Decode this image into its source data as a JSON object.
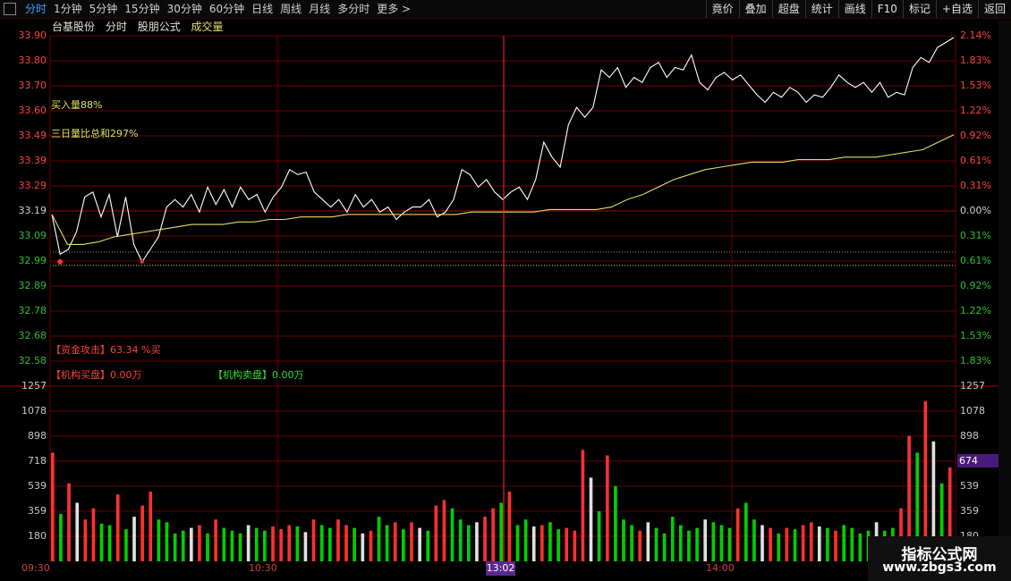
{
  "toolbar": {
    "tabs": [
      "分时",
      "1分钟",
      "5分钟",
      "15分钟",
      "30分钟",
      "60分钟",
      "日线",
      "周线",
      "月线",
      "多分时",
      "更多 >"
    ],
    "active_tab": "分时",
    "right_buttons": [
      "竟价",
      "叠加",
      "超盘",
      "统计",
      "画线",
      "F10",
      "标记",
      "+自选",
      "返回"
    ]
  },
  "chart_header": {
    "stock_name": "台基股份",
    "mode": "分时",
    "formula": "股朋公式",
    "indicator": "成交量"
  },
  "annotations": {
    "buy_ratio": "买入量88%",
    "three_day": "三日量比总和297%",
    "fund_attack": "【资金攻击】63.34 %买",
    "inst_buy": "【机构买盘】0.00万",
    "inst_sell": "【机构卖盘】0.00万"
  },
  "price_axis": {
    "left": [
      "33.90",
      "33.80",
      "33.70",
      "33.60",
      "33.49",
      "33.39",
      "33.29",
      "33.19",
      "33.09",
      "32.99",
      "32.89",
      "32.78",
      "32.68",
      "32.58"
    ],
    "right": [
      "2.14%",
      "1.83%",
      "1.53%",
      "1.22%",
      "0.92%",
      "0.61%",
      "0.31%",
      "0.00%",
      "0.31%",
      "0.61%",
      "0.92%",
      "1.22%",
      "1.53%",
      "1.83%"
    ]
  },
  "volume_axis": [
    "1257",
    "1078",
    "898",
    "718",
    "539",
    "359",
    "180"
  ],
  "volume_current": "674",
  "time_axis": [
    "09:30",
    "10:30",
    "13:02",
    "14:00"
  ],
  "watermark": {
    "title": "指标公式网",
    "url": "www.zbgs3.com"
  },
  "colors": {
    "up": "#ff3030",
    "down": "#00d000",
    "price_line": "#ffffff",
    "avg_line": "#e0e060",
    "grid": "#6a0000",
    "axis_up": "#ff4040",
    "axis_down": "#30c030"
  },
  "chart_data": {
    "type": "line",
    "price": [
      33.19,
      33.03,
      33.05,
      33.12,
      33.26,
      33.28,
      33.18,
      33.27,
      33.1,
      33.26,
      33.07,
      33.0,
      33.05,
      33.1,
      33.22,
      33.25,
      33.22,
      33.27,
      33.2,
      33.3,
      33.23,
      33.29,
      33.22,
      33.3,
      33.25,
      33.27,
      33.2,
      33.26,
      33.3,
      33.37,
      33.35,
      33.36,
      33.28,
      33.25,
      33.22,
      33.25,
      33.2,
      33.27,
      33.22,
      33.25,
      33.2,
      33.22,
      33.17,
      33.2,
      33.22,
      33.22,
      33.25,
      33.18,
      33.2,
      33.25,
      33.37,
      33.35,
      33.3,
      33.33,
      33.28,
      33.25,
      33.28,
      33.3,
      33.25,
      33.33,
      33.48,
      33.42,
      33.38,
      33.55,
      33.62,
      33.58,
      33.62,
      33.77,
      33.74,
      33.78,
      33.7,
      33.74,
      33.72,
      33.78,
      33.8,
      33.74,
      33.78,
      33.77,
      33.83,
      33.72,
      33.69,
      33.74,
      33.76,
      33.73,
      33.75,
      33.71,
      33.67,
      33.64,
      33.68,
      33.66,
      33.7,
      33.68,
      33.64,
      33.67,
      33.66,
      33.7,
      33.75,
      33.72,
      33.7,
      33.72,
      33.68,
      33.72,
      33.66,
      33.68,
      33.67,
      33.78,
      33.82,
      33.8,
      33.86,
      33.88,
      33.9
    ],
    "avg": [
      33.19,
      33.07,
      33.07,
      33.08,
      33.1,
      33.11,
      33.12,
      33.13,
      33.14,
      33.15,
      33.15,
      33.15,
      33.16,
      33.16,
      33.17,
      33.17,
      33.18,
      33.18,
      33.18,
      33.19,
      33.19,
      33.19,
      33.19,
      33.19,
      33.19,
      33.19,
      33.19,
      33.2,
      33.2,
      33.2,
      33.2,
      33.2,
      33.21,
      33.21,
      33.21,
      33.21,
      33.22,
      33.25,
      33.27,
      33.3,
      33.33,
      33.35,
      33.37,
      33.38,
      33.39,
      33.4,
      33.4,
      33.4,
      33.41,
      33.41,
      33.41,
      33.42,
      33.42,
      33.42,
      33.43,
      33.44,
      33.45,
      33.48,
      33.51
    ],
    "volume": [
      780,
      340,
      560,
      420,
      300,
      380,
      270,
      260,
      480,
      230,
      320,
      400,
      500,
      300,
      280,
      200,
      220,
      240,
      260,
      200,
      300,
      240,
      220,
      200,
      260,
      240,
      220,
      250,
      230,
      260,
      250,
      210,
      300,
      260,
      240,
      300,
      260,
      240,
      200,
      220,
      320,
      260,
      280,
      230,
      280,
      240,
      220,
      400,
      440,
      380,
      300,
      260,
      280,
      320,
      380,
      420,
      500,
      260,
      300,
      250,
      260,
      280,
      230,
      240,
      220,
      800,
      600,
      360,
      760,
      540,
      300,
      260,
      220,
      280,
      240,
      200,
      320,
      260,
      220,
      240,
      300,
      280,
      260,
      240,
      380,
      420,
      300,
      260,
      240,
      200,
      240,
      230,
      260,
      280,
      250,
      240,
      220,
      260,
      240,
      200,
      220,
      280,
      220,
      240,
      380,
      900,
      780,
      1150,
      860,
      560,
      674
    ],
    "price_range": [
      32.58,
      33.9
    ],
    "volume_range": [
      0,
      1257
    ]
  }
}
